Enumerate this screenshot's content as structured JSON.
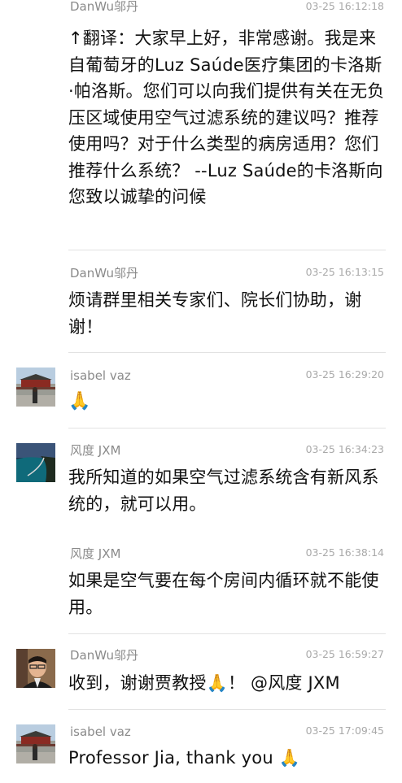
{
  "messages": [
    {
      "sender": "DanWu邬丹",
      "time": "03-25 16:12:18",
      "text": "↑翻译：大家早上好，非常感谢。我是来自葡萄牙的Luz Saúde医疗集团的卡洛斯·帕洛斯。您们可以向我们提供有关在无负压区域使用空气过滤系统的建议吗？推荐使用吗？对于什么类型的病房适用？您们推荐什么系统？ --Luz Saúde的卡洛斯向您致以诚挚的问候",
      "avatar": "none"
    },
    {
      "sender": "DanWu邬丹",
      "time": "03-25 16:13:15",
      "text": "烦请群里相关专家们、院长们协助，谢谢！",
      "avatar": "none"
    },
    {
      "sender": "isabel vaz",
      "time": "03-25 16:29:20",
      "text": "🙏",
      "avatar": "forbidden-city-photo"
    },
    {
      "sender": "风度 JXM",
      "time": "03-25 16:34:23",
      "text": "我所知道的如果空气过滤系统含有新风系统的，就可以用。",
      "avatar": "coastal-road-photo"
    },
    {
      "sender": "风度 JXM",
      "time": "03-25 16:38:14",
      "text": "如果是空气要在每个房间内循环就不能使用。",
      "avatar": "none"
    },
    {
      "sender": "DanWu邬丹",
      "time": "03-25 16:59:27",
      "text": "收到，谢谢贾教授🙏！ @风度 JXM",
      "avatar": "man-with-glasses-photo"
    },
    {
      "sender": "isabel vaz",
      "time": "03-25 17:09:45",
      "text": "Professor Jia, thank you 🙏",
      "avatar": "forbidden-city-photo"
    }
  ]
}
